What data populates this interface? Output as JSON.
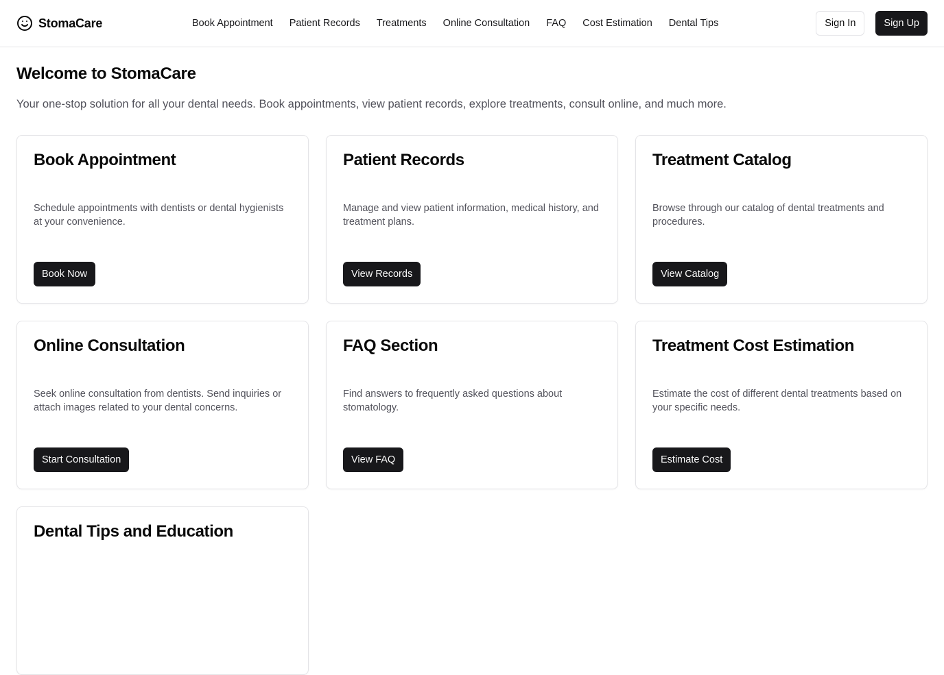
{
  "brand": {
    "name": "StomaCare",
    "icon": "smile-icon"
  },
  "nav": {
    "items": [
      {
        "label": "Book Appointment"
      },
      {
        "label": "Patient Records"
      },
      {
        "label": "Treatments"
      },
      {
        "label": "Online Consultation"
      },
      {
        "label": "FAQ"
      },
      {
        "label": "Cost Estimation"
      },
      {
        "label": "Dental Tips"
      }
    ]
  },
  "auth": {
    "sign_in": "Sign In",
    "sign_up": "Sign Up"
  },
  "hero": {
    "title": "Welcome to StomaCare",
    "subtitle": "Your one-stop solution for all your dental needs. Book appointments, view patient records, explore treatments, consult online, and much more."
  },
  "cards": [
    {
      "title": "Book Appointment",
      "description": "Schedule appointments with dentists or dental hygienists at your convenience.",
      "button": "Book Now"
    },
    {
      "title": "Patient Records",
      "description": "Manage and view patient information, medical history, and treatment plans.",
      "button": "View Records"
    },
    {
      "title": "Treatment Catalog",
      "description": "Browse through our catalog of dental treatments and procedures.",
      "button": "View Catalog"
    },
    {
      "title": "Online Consultation",
      "description": "Seek online consultation from dentists. Send inquiries or attach images related to your dental concerns.",
      "button": "Start Consultation"
    },
    {
      "title": "FAQ Section",
      "description": "Find answers to frequently asked questions about stomatology.",
      "button": "View FAQ"
    },
    {
      "title": "Treatment Cost Estimation",
      "description": "Estimate the cost of different dental treatments based on your specific needs.",
      "button": "Estimate Cost"
    },
    {
      "title": "Dental Tips and Education"
    }
  ],
  "colors": {
    "primary": "#18181b",
    "border": "#e4e4e7",
    "muted_text": "#52525b",
    "background": "#ffffff"
  }
}
